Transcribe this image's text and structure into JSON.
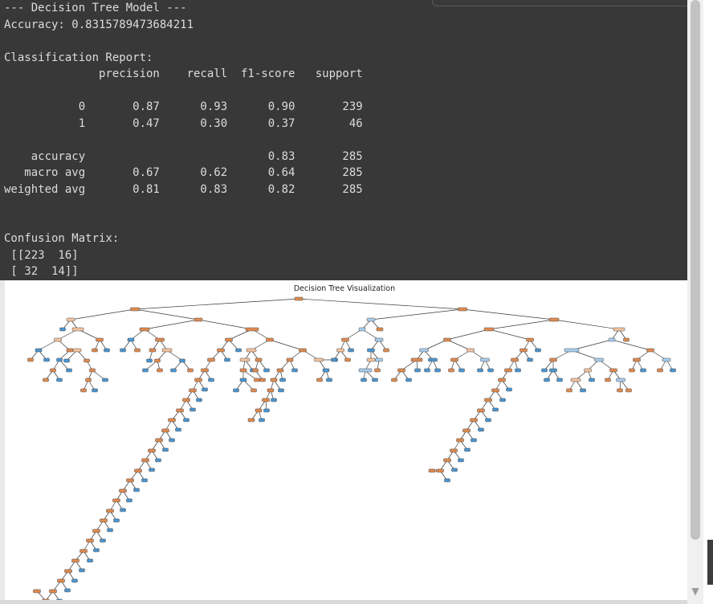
{
  "console": {
    "lines": [
      "--- Decision Tree Model ---",
      "Accuracy: 0.8315789473684211",
      "",
      "Classification Report:",
      "              precision    recall  f1-score   support",
      "",
      "           0       0.87      0.93      0.90       239",
      "           1       0.47      0.30      0.37        46",
      "",
      "    accuracy                           0.83       285",
      "   macro avg       0.67      0.62      0.64       285",
      "weighted avg       0.81      0.83      0.82       285",
      "",
      "",
      "Confusion Matrix:",
      " [[223  16]",
      " [ 32  14]]"
    ]
  },
  "figure": {
    "title": "Decision Tree Visualization"
  },
  "scrollbar": {
    "down_arrow": "▼"
  },
  "colors": {
    "console_bg": "#383838",
    "console_text": "#dcdcdc",
    "node_orange_dark": "#e08b50",
    "node_orange_light": "#f2c3a0",
    "node_blue_dark": "#4b96d2",
    "node_blue_light": "#a8cdec",
    "node_edge": "#4a4a4a"
  }
}
